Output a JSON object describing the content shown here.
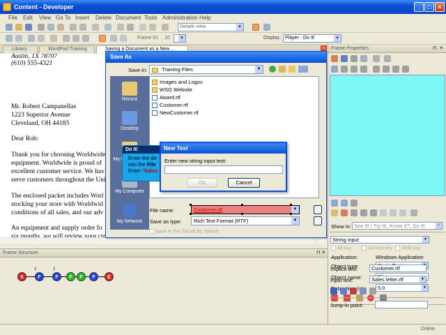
{
  "window": {
    "title": "Content - Developer",
    "controls": [
      "_",
      "□",
      "×"
    ]
  },
  "menu": [
    "File",
    "Edit",
    "View",
    "Go To",
    "Insert",
    "Delete",
    "Document",
    "Tools",
    "Administration",
    "Help"
  ],
  "toolbar": {
    "view_combo": "Details view",
    "frame_label": "Frame ID:",
    "frame_id": "10",
    "display_label": "Display:",
    "display_value": "Player - Do It!"
  },
  "doc_tabs": [
    "Library",
    "WordPad Training",
    "Saving a Document as a New ..."
  ],
  "document": {
    "lines": [
      "Austin, TX 78707",
      "(610) 555-4321",
      "Mr. Robert Campanellas",
      "1223 Superior Avenue",
      "Cleveland, OH  44183",
      "Dear Rob:",
      "Thank you for choosing Worldwide",
      "equipment.  Worldwide is proud of",
      "excellent customer service.  We hav",
      "serve customers throughout the Uni",
      "The enclosed packet includes Worl",
      "stocking your store with Worldwid",
      "conditions of all sales, and our adv",
      "An equipment and supply order fo",
      "six months, we will review your credit"
    ]
  },
  "save_as": {
    "title": "Save As",
    "save_in_label": "Save in:",
    "save_in_value": "Training Files",
    "places": [
      "Recent",
      "Desktop",
      "My Documents",
      "My Computer",
      "My Network"
    ],
    "files": [
      {
        "name": "Images and Logos",
        "type": "folder"
      },
      {
        "name": "WSG Website",
        "type": "folder"
      },
      {
        "name": "Award.rtf",
        "type": "file"
      },
      {
        "name": "Customer.rtf",
        "type": "file"
      },
      {
        "name": "NewCustomer.rtf",
        "type": "file"
      }
    ],
    "filename_label": "File name:",
    "filename_value": "Customer.rtf",
    "savetype_label": "Save as type:",
    "savetype_value": "Rich Text Format (RTF)",
    "default_check": "Save in this format by default"
  },
  "do_it": {
    "title": "Do It!",
    "line1": "Enter the de",
    "line2a": "into the ",
    "line2b": "File",
    "line3a": "Enter \"",
    "line3b": "Sales"
  },
  "new_text": {
    "title": "New Text",
    "prompt": "Enter new string input text:",
    "value": "",
    "ok": "OK",
    "cancel": "Cancel"
  },
  "frame_structure": {
    "title": "Frame Structure",
    "nodes": [
      {
        "label": "S",
        "color": "#e02020"
      },
      {
        "label": "F",
        "color": "#2040e8",
        "sup": "2"
      },
      {
        "label": "F",
        "color": "#2040e8",
        "sup": "2"
      },
      {
        "label": "F",
        "color": "#20c020"
      },
      {
        "label": "F",
        "color": "#20c020"
      },
      {
        "label": "F",
        "color": "#2040e8"
      },
      {
        "label": "E",
        "color": "#e02020"
      }
    ]
  },
  "frame_properties": {
    "title": "Frame Properties",
    "tab_label": "Show in:",
    "tab_value": "See It! / Try It!, Know It?, Do It!",
    "action_type": "String input",
    "checks": [
      "Alt key",
      "Control key",
      "Shift key"
    ],
    "application_label": "Application:",
    "application_value": "Windows Application",
    "object_type_label": "Object type:",
    "object_type_value": "Static Text",
    "object_name_label": "Object name:",
    "object_name_value": "File name",
    "delay_label": "Delay time (s):",
    "delay_value": "5.0",
    "implicit_label": "Implicit text:",
    "implicit_value": "Customer.rtf",
    "input_label": "Input text:",
    "input_value": "Sales letter.rtf",
    "jump_label": "Jump-in point:",
    "jump_value": ""
  },
  "status": {
    "online": "Online"
  }
}
